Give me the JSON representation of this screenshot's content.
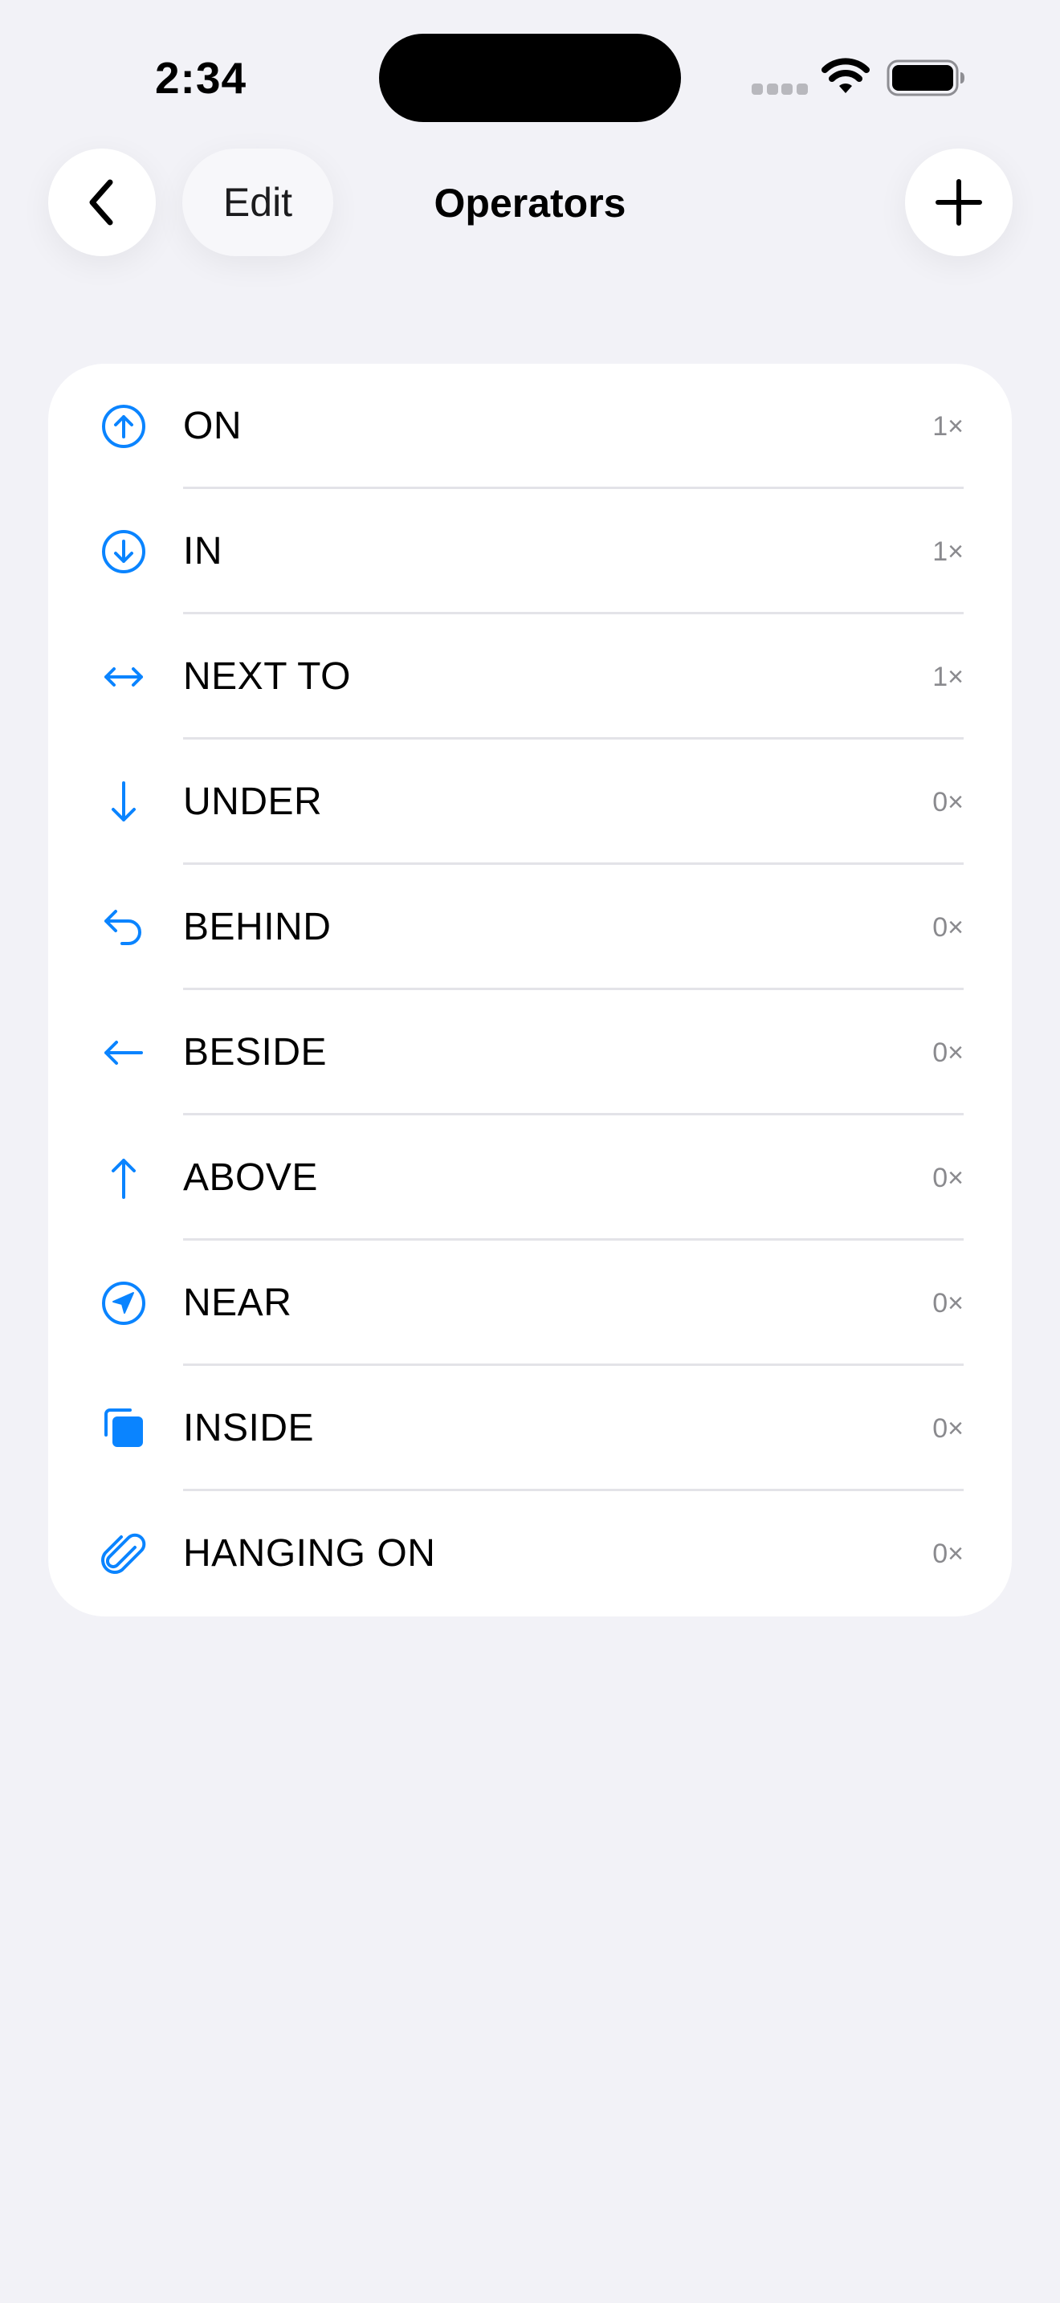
{
  "status_bar": {
    "time": "2:34"
  },
  "nav": {
    "edit_label": "Edit",
    "title": "Operators"
  },
  "accent_color": "#0a84ff",
  "operators": [
    {
      "label": "ON",
      "count": "1×",
      "icon": "arrow-up-circle-icon"
    },
    {
      "label": "IN",
      "count": "1×",
      "icon": "arrow-down-circle-icon"
    },
    {
      "label": "NEXT TO",
      "count": "1×",
      "icon": "arrow-left-right-icon"
    },
    {
      "label": "UNDER",
      "count": "0×",
      "icon": "arrow-down-icon"
    },
    {
      "label": "BEHIND",
      "count": "0×",
      "icon": "arrow-uturn-left-icon"
    },
    {
      "label": "BESIDE",
      "count": "0×",
      "icon": "arrow-left-icon"
    },
    {
      "label": "ABOVE",
      "count": "0×",
      "icon": "arrow-up-icon"
    },
    {
      "label": "NEAR",
      "count": "0×",
      "icon": "location-circle-icon"
    },
    {
      "label": "INSIDE",
      "count": "0×",
      "icon": "squares-stacked-icon"
    },
    {
      "label": "HANGING ON",
      "count": "0×",
      "icon": "paperclip-icon"
    }
  ]
}
